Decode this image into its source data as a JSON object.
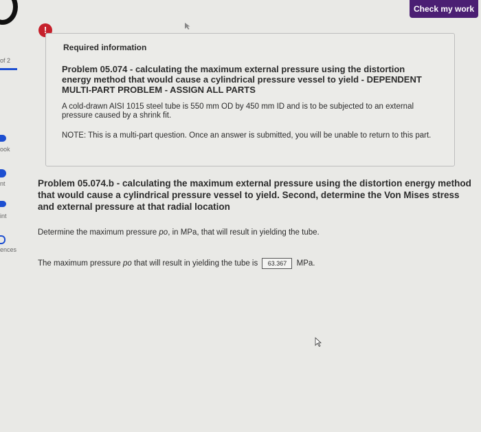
{
  "header": {
    "check_button": "Check my work"
  },
  "sidebar": {
    "page": "of 2",
    "items": [
      "ook",
      "nt",
      "int",
      "ences"
    ]
  },
  "alert": {
    "symbol": "!"
  },
  "info": {
    "title": "Required information",
    "problem": "Problem 05.074 - calculating the maximum external pressure using the distortion energy method that would cause a cylindrical pressure vessel to yield - DEPENDENT MULTI-PART PROBLEM - ASSIGN ALL PARTS",
    "body": "A cold-drawn AISI 1015 steel tube is 550 mm OD by 450 mm ID and is to be subjected to an external pressure caused by a shrink fit.",
    "note": "NOTE: This is a multi-part question. Once an answer is submitted, you will be unable to return to this part."
  },
  "question": {
    "title": "Problem 05.074.b - calculating the maximum external pressure using the distortion energy method that would cause a cylindrical pressure vessel to yield. Second, determine the Von Mises stress and external pressure at that radial location",
    "determine_prefix": "Determine the maximum pressure ",
    "determine_var": "po",
    "determine_suffix": ", in MPa, that will result in yielding the tube.",
    "answer_prefix": "The maximum pressure ",
    "answer_var": "po",
    "answer_mid": " that will result in yielding the tube is",
    "answer_value": "63.367",
    "answer_unit": "MPa."
  },
  "colors": {
    "accent": "#4b1f73",
    "alert": "#c6202b",
    "sidebar_blue": "#1d4fd1"
  }
}
